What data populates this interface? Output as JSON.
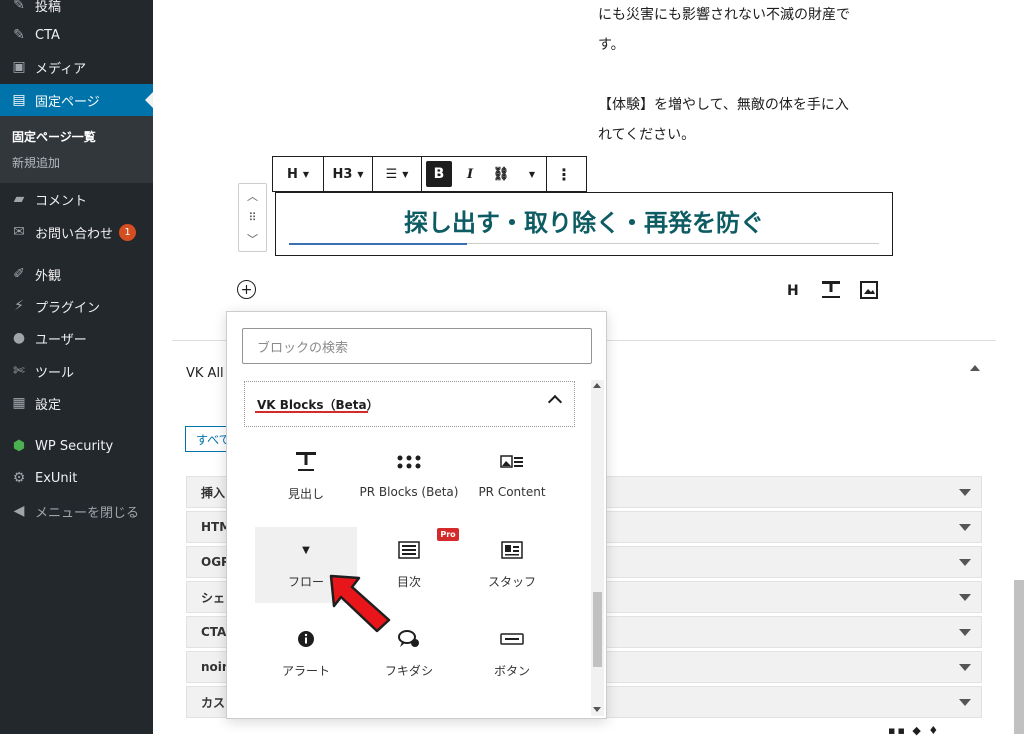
{
  "sidebar": {
    "items": [
      {
        "label": "投稿",
        "icon": "pin-icon"
      },
      {
        "label": "CTA",
        "icon": "pin-icon"
      },
      {
        "label": "メディア",
        "icon": "media-icon"
      },
      {
        "label": "固定ページ",
        "icon": "page-icon"
      },
      {
        "label": "コメント",
        "icon": "comment-icon"
      },
      {
        "label": "お問い合わせ",
        "icon": "mail-icon",
        "badge": "1"
      },
      {
        "label": "外観",
        "icon": "brush-icon"
      },
      {
        "label": "プラグイン",
        "icon": "plugin-icon"
      },
      {
        "label": "ユーザー",
        "icon": "user-icon"
      },
      {
        "label": "ツール",
        "icon": "wrench-icon"
      },
      {
        "label": "設定",
        "icon": "settings-icon"
      },
      {
        "label": "WP Security",
        "icon": "shield-icon"
      },
      {
        "label": "ExUnit",
        "icon": "gear-icon"
      },
      {
        "label": "メニューを閉じる",
        "icon": "collapse-icon"
      }
    ],
    "submenu": [
      "固定ページ一覧",
      "新規追加"
    ]
  },
  "content": {
    "para_lines": [
      "にも災害にも影響されない不滅の財産で",
      "す。",
      "【体験】を増やして、無敵の体を手に入",
      "れてください。"
    ],
    "heading": "探し出す・取り除く・再発を防ぐ"
  },
  "toolbar": {
    "h": "H",
    "h3": "H3",
    "bold": "B",
    "italic": "I"
  },
  "quick_inserter": {
    "h": "H"
  },
  "inserter": {
    "search_placeholder": "ブロックの検索",
    "category": "VK Blocks（Beta）",
    "pro_label": "Pro",
    "blocks": [
      {
        "label": "見出し",
        "icon": "subtext-heading-icon"
      },
      {
        "label": "PR Blocks (Beta)",
        "icon": "grid-dots-icon"
      },
      {
        "label": "PR Content",
        "icon": "pr-content-icon"
      },
      {
        "label": "フロー",
        "icon": "flow-arrow-icon"
      },
      {
        "label": "目次",
        "icon": "toc-icon"
      },
      {
        "label": "スタッフ",
        "icon": "staff-icon"
      },
      {
        "label": "アラート",
        "icon": "info-icon"
      },
      {
        "label": "フキダシ",
        "icon": "balloon-icon"
      },
      {
        "label": "ボタン",
        "icon": "button-icon"
      }
    ]
  },
  "metabox": {
    "title": "VK All",
    "tab": "すべて",
    "rows": [
      "挿入",
      "HTM",
      "OGP",
      "シェ",
      "CTA",
      "noin",
      "カス"
    ]
  },
  "colors": {
    "accent": "#0073aa",
    "heading": "#0d5c63",
    "annotation": "#d52a2a"
  }
}
